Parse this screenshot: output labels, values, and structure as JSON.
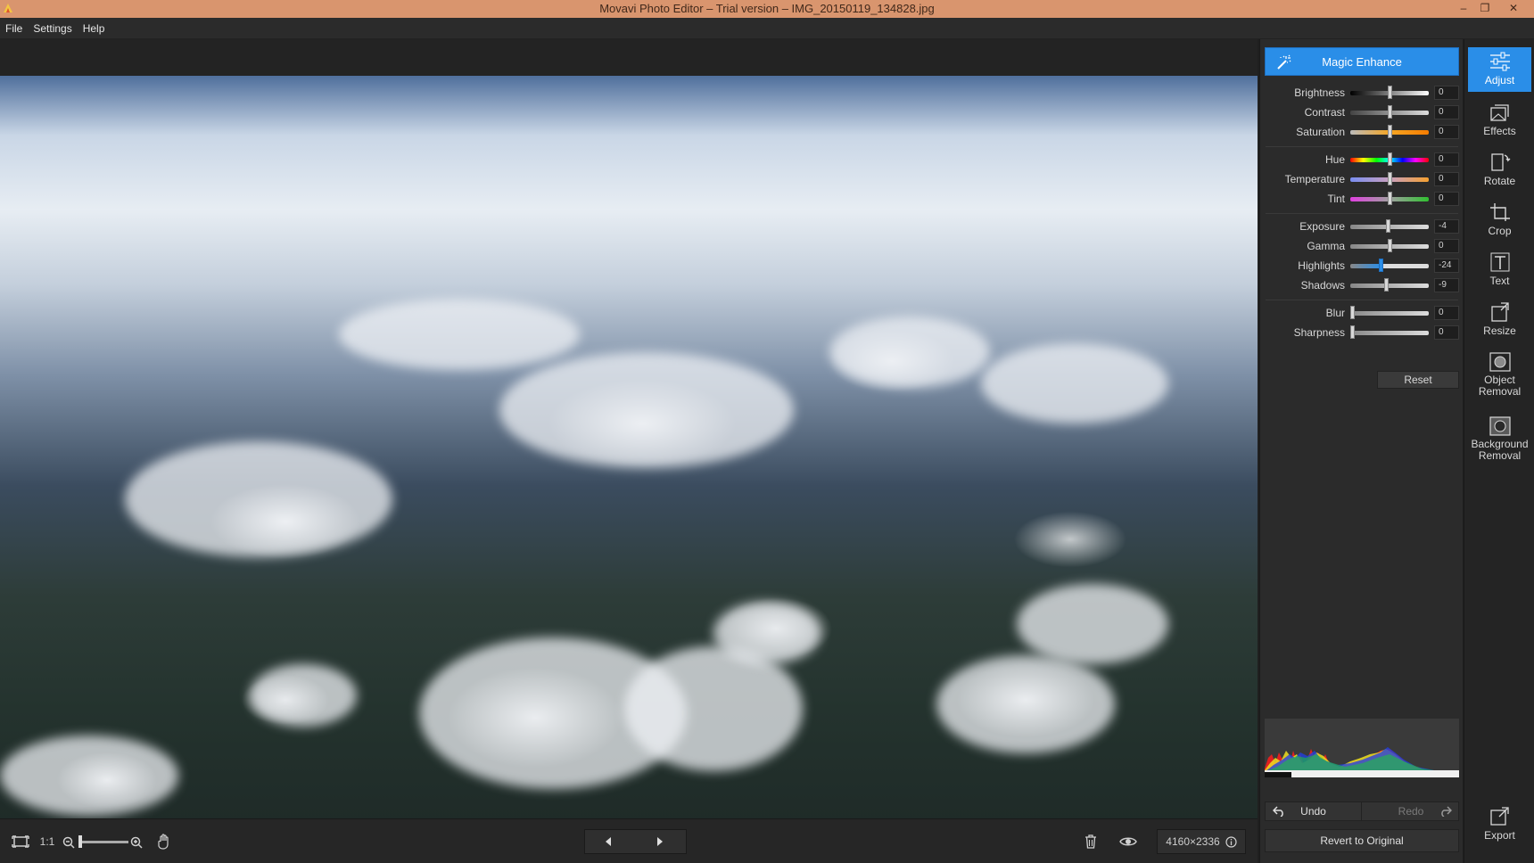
{
  "window": {
    "title": "Movavi Photo Editor – Trial version – IMG_20150119_134828.jpg",
    "minimize": "–",
    "maximize": "❐",
    "close": "✕"
  },
  "menu": [
    "File",
    "Settings",
    "Help"
  ],
  "adjust": {
    "magic_enhance": "Magic Enhance",
    "sliders": [
      {
        "label": "Brightness",
        "value": "0"
      },
      {
        "label": "Contrast",
        "value": "0"
      },
      {
        "label": "Saturation",
        "value": "0"
      },
      {
        "label": "Hue",
        "value": "0"
      },
      {
        "label": "Temperature",
        "value": "0"
      },
      {
        "label": "Tint",
        "value": "0"
      },
      {
        "label": "Exposure",
        "value": "-4"
      },
      {
        "label": "Gamma",
        "value": "0"
      },
      {
        "label": "Highlights",
        "value": "-24"
      },
      {
        "label": "Shadows",
        "value": "-9"
      },
      {
        "label": "Blur",
        "value": "0"
      },
      {
        "label": "Sharpness",
        "value": "0"
      }
    ],
    "reset": "Reset"
  },
  "history": {
    "undo": "Undo",
    "redo": "Redo",
    "revert": "Revert to Original"
  },
  "tools": [
    {
      "label": "Adjust",
      "icon": "sliders-icon",
      "active": true
    },
    {
      "label": "Effects",
      "icon": "effects-icon"
    },
    {
      "label": "Rotate",
      "icon": "rotate-icon"
    },
    {
      "label": "Crop",
      "icon": "crop-icon"
    },
    {
      "label": "Text",
      "icon": "text-icon"
    },
    {
      "label": "Resize",
      "icon": "resize-icon"
    },
    {
      "label": "Object\nRemoval",
      "icon": "object-removal-icon"
    },
    {
      "label": "Background\nRemoval",
      "icon": "background-removal-icon"
    },
    {
      "label": "Export",
      "icon": "export-icon"
    }
  ],
  "bottom": {
    "zoom_ratio": "1:1",
    "dimensions": "4160×2336"
  },
  "colors": {
    "accent": "#2a8ee8",
    "titlebar": "#d9956e"
  }
}
